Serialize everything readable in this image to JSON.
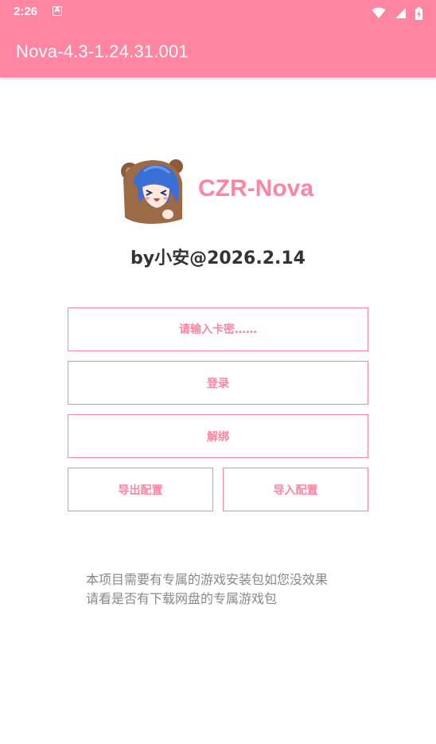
{
  "status_bar": {
    "time": "2:26",
    "notification_icon": "A",
    "icons": [
      "wifi-icon",
      "signal-icon",
      "battery-charging-icon"
    ]
  },
  "app_bar": {
    "title": "Nova-4.3-1.24.31.001",
    "color": "#ff85a2"
  },
  "header": {
    "logo": "anime-character-logo",
    "brand": "CZR-Nova",
    "byline": "by小安@2026.2.14"
  },
  "form": {
    "card_key_placeholder": "请输入卡密……",
    "card_key_value": "",
    "login_label": "登录",
    "unbind_label": "解绑",
    "export_label": "导出配置",
    "import_label": "导入配置"
  },
  "notice": {
    "line1": "本项目需要有专属的游戏安装包如您没效果",
    "line2": "请看是否有下载网盘的专属游戏包"
  },
  "colors": {
    "accent": "#ff85a2",
    "text_dark": "#333333",
    "text_muted": "#888888"
  }
}
